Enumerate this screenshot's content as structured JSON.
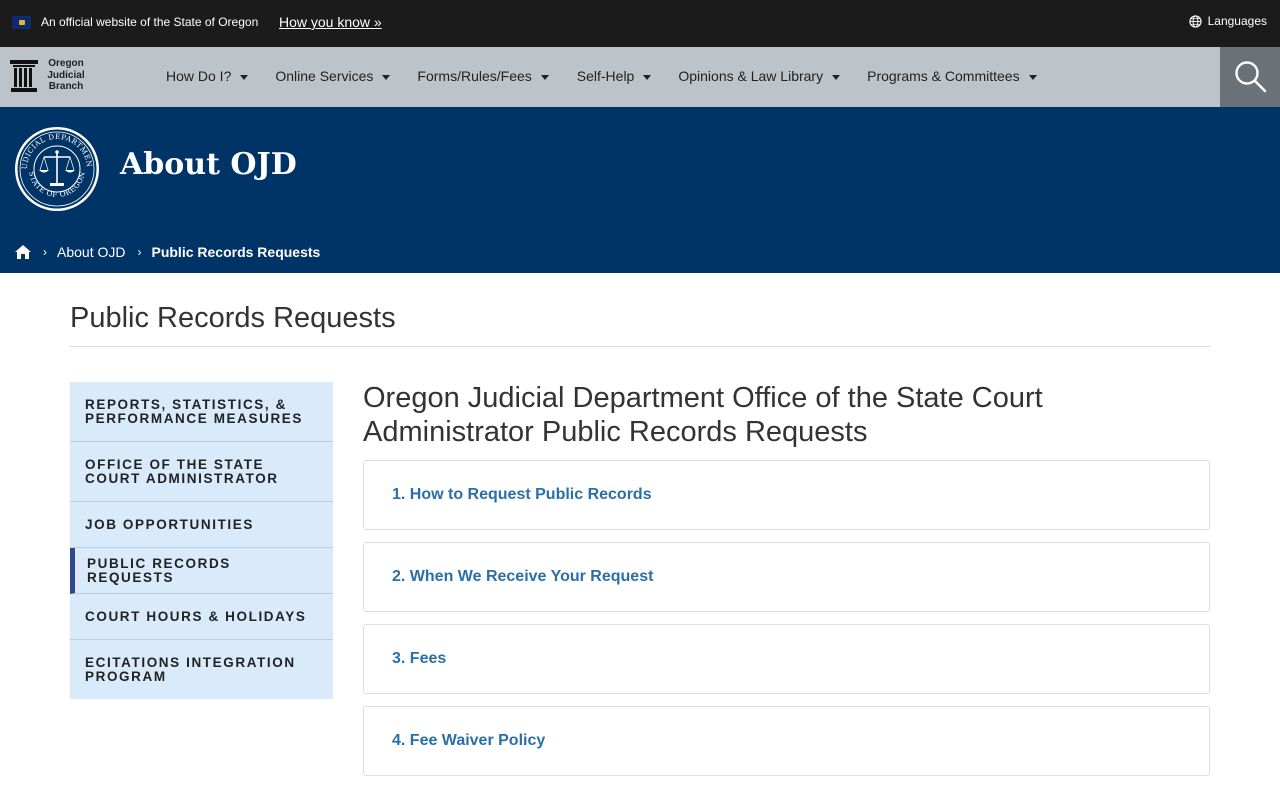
{
  "topbar": {
    "official_text": "An official website of the State of Oregon",
    "how_you_know": "How you know »",
    "languages": "Languages"
  },
  "logo": {
    "line1": "Oregon",
    "line2": "Judicial",
    "line3": "Branch"
  },
  "nav": {
    "items": [
      {
        "label": "How Do I?"
      },
      {
        "label": "Online Services"
      },
      {
        "label": "Forms/Rules/Fees"
      },
      {
        "label": "Self-Help"
      },
      {
        "label": "Opinions & Law Library"
      },
      {
        "label": "Programs & Committees"
      }
    ]
  },
  "hero": {
    "title": "About OJD",
    "seal_top": "JUDICIAL DEPARTMENT",
    "seal_bottom": "STATE OF OREGON"
  },
  "breadcrumb": {
    "parent": "About OJD",
    "current": "Public Records Requests"
  },
  "page": {
    "title": "Public Records Requests",
    "heading": "Oregon Judicial Department Office of the State Court Administrator Public Records Requests"
  },
  "sidebar": {
    "items": [
      {
        "label": "Reports, Statistics, & Performance Measures"
      },
      {
        "label": "Office of the State Court Administrator"
      },
      {
        "label": "Job Opportunities"
      },
      {
        "label": "Public Records Requests"
      },
      {
        "label": "Court Hours & Holidays"
      },
      {
        "label": "eCitations Integration Program"
      }
    ]
  },
  "accordion": {
    "items": [
      {
        "label": "1. How to Request Public Records"
      },
      {
        "label": "2. When We Receive Your Request"
      },
      {
        "label": "3. Fees"
      },
      {
        "label": "4. Fee Waiver Policy"
      }
    ]
  },
  "colors": {
    "topbar": "#1b1b1b",
    "navbar": "#bcc3c9",
    "hero": "#003366",
    "sidebar": "#d9eafb",
    "link": "#2a6fa8"
  }
}
